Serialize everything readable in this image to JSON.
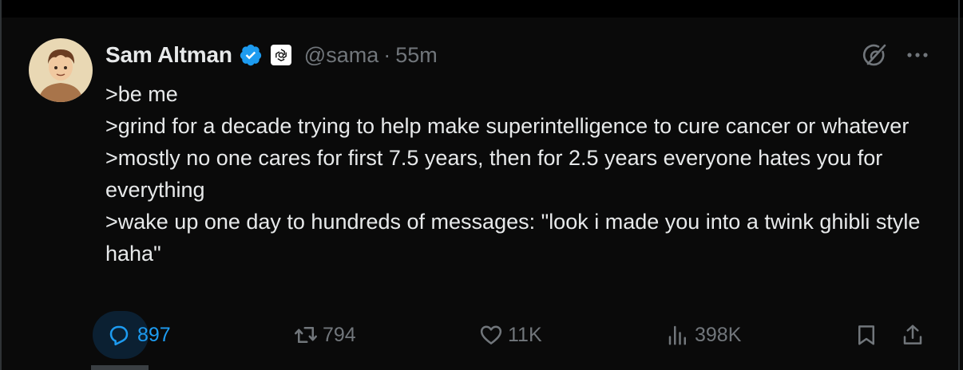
{
  "post": {
    "author_name": "Sam Altman",
    "handle": "@sama",
    "separator": "·",
    "time": "55m",
    "lines": [
      ">be me",
      ">grind for a decade trying to help make superintelligence to cure cancer or whatever",
      ">mostly no one cares for first 7.5 years, then for 2.5 years everyone hates you for everything",
      ">wake up one day to hundreds of messages: \"look i made you into a twink ghibli style haha\""
    ]
  },
  "actions": {
    "replies": "897",
    "reposts": "794",
    "likes": "11K",
    "views": "398K"
  },
  "colors": {
    "accent": "#1d9bf0",
    "muted": "#71767b",
    "text": "#e7e9ea",
    "background": "#0a0a0a"
  }
}
